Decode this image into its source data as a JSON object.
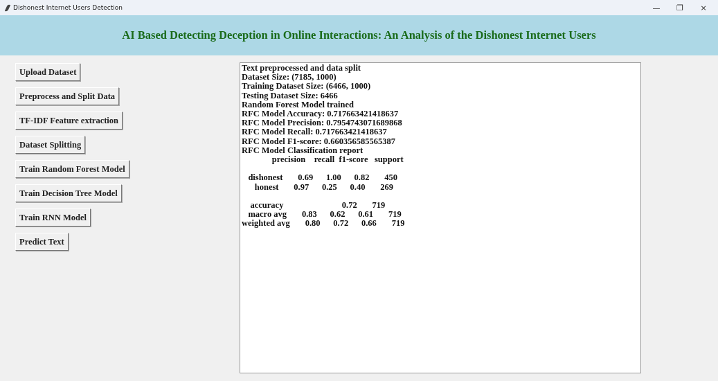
{
  "window": {
    "title": "Dishonest Internet Users Detection",
    "controls": [
      "—",
      "❐",
      "×"
    ]
  },
  "header": {
    "title": "AI Based Detecting Deception in Online Interactions: An Analysis of the Dishonest Internet Users"
  },
  "buttons": [
    "Upload Dataset",
    "Preprocess and Split Data",
    "TF-IDF Feature extraction",
    "Dataset Splitting",
    "Train Random Forest Model",
    "Train Decision Tree Model",
    "Train RNN Model",
    "Predict Text"
  ],
  "output": {
    "paragraphs": [
      [
        "Text preprocessed and data split",
        "Dataset Size: (7185, 1000)",
        "Training Dataset Size: (6466, 1000)",
        "Testing Dataset Size: 6466",
        "Random Forest Model trained",
        "RFC Model Accuracy: 0.717663421418637",
        "RFC Model Precision: 0.7954743071689868",
        "RFC Model Recall: 0.717663421418637",
        "RFC Model F1-score: 0.660356585565387",
        "RFC Model Classification report",
        "              precision    recall  f1-score   support"
      ],
      [
        "   dishonest       0.69      1.00      0.82       450",
        "      honest       0.97      0.25      0.40       269"
      ],
      [
        "    accuracy                           0.72       719",
        "   macro avg       0.83      0.62      0.61       719",
        "weighted avg       0.80      0.72      0.66       719"
      ]
    ]
  }
}
